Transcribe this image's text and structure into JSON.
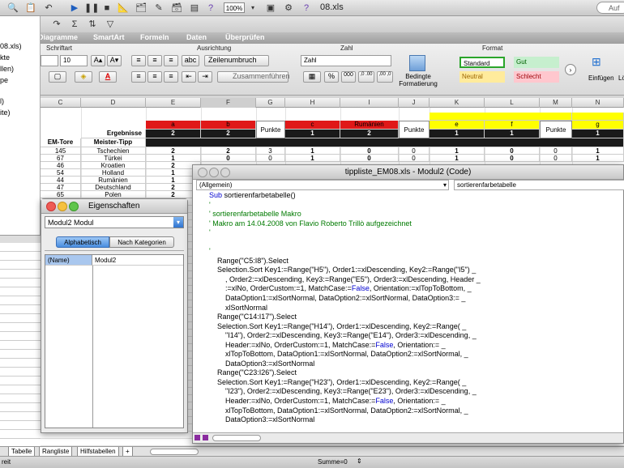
{
  "toolbar": {
    "zoom": "100%",
    "title": "08.xls",
    "search_placeholder": "Auf de"
  },
  "ribbon": {
    "tabs": [
      "Diagramme",
      "SmartArt",
      "Formeln",
      "Daten",
      "Überprüfen"
    ],
    "groups": {
      "schriftart": "Schriftart",
      "ausrichtung": "Ausrichtung",
      "zahl": "Zahl",
      "format": "Format"
    },
    "font_size": "10",
    "wrap_label": "Zeilenumbruch",
    "merge_label": "Zusammenführen",
    "number_format": "Zahl",
    "percent": "%",
    "thousands": "000",
    "dec_inc": ",0 .00",
    "dec_dec": ",00 ,0",
    "cond_format": [
      "Bedingte",
      "Formatierung"
    ],
    "styles": [
      {
        "label": "Standard",
        "bg": "#ffffff",
        "border": "#2aa52a"
      },
      {
        "label": "Gut",
        "bg": "#c6efce",
        "border": "#c6efce"
      },
      {
        "label": "Neutral",
        "bg": "#ffeb9c",
        "border": "#ffeb9c"
      },
      {
        "label": "Schlecht",
        "bg": "#ffc7ce",
        "border": "#ffc7ce"
      }
    ],
    "einfuegen": "Einfügen",
    "loeschen": "Lö"
  },
  "project_pane": {
    "lines": [
      "08.xls)",
      "kte",
      "llen)",
      "pe",
      "l)",
      "ite)"
    ]
  },
  "sheet": {
    "columns": [
      "C",
      "D",
      "E",
      "F",
      "G",
      "H",
      "I",
      "J",
      "K",
      "L",
      "M",
      "N"
    ],
    "ergebnisse": "Ergebnisse",
    "em_tore": "EM-Tore",
    "meister_tipp": "Meister-Tipp",
    "header_labels": {
      "e": "a",
      "f": "b",
      "g": "Punkte",
      "h": "c",
      "i": "Rumänien",
      "j": "Punkte",
      "k": "e",
      "l": "f",
      "m": "Punkte",
      "n": "g"
    },
    "score_row": [
      "2",
      "2",
      "",
      "1",
      "2",
      "",
      "1",
      "1",
      "",
      "1"
    ],
    "rows": [
      {
        "c": "145",
        "d": "Tschechien",
        "e": "2",
        "f": "2",
        "g": "3",
        "h": "1",
        "i": "0",
        "j": "0",
        "k": "1",
        "l": "0",
        "m": "0",
        "n": "1"
      },
      {
        "c": "67",
        "d": "Türkei",
        "e": "1",
        "f": "0",
        "g": "0",
        "h": "1",
        "i": "0",
        "j": "0",
        "k": "1",
        "l": "0",
        "m": "0",
        "n": "1"
      },
      {
        "c": "46",
        "d": "Kroatien",
        "e": "2",
        "f": "",
        "g": "",
        "h": "",
        "i": "",
        "j": "",
        "k": "",
        "l": "",
        "m": "",
        "n": ""
      },
      {
        "c": "54",
        "d": "Holland",
        "e": "1",
        "f": "",
        "g": "",
        "h": "",
        "i": "",
        "j": "",
        "k": "",
        "l": "",
        "m": "",
        "n": ""
      },
      {
        "c": "44",
        "d": "Rumänien",
        "e": "1",
        "f": "",
        "g": "",
        "h": "",
        "i": "",
        "j": "",
        "k": "",
        "l": "",
        "m": "",
        "n": ""
      },
      {
        "c": "47",
        "d": "Deutschland",
        "e": "2",
        "f": "",
        "g": "",
        "h": "",
        "i": "",
        "j": "",
        "k": "",
        "l": "",
        "m": "",
        "n": ""
      },
      {
        "c": "65",
        "d": "Polen",
        "e": "2",
        "f": "",
        "g": "",
        "h": "",
        "i": "",
        "j": "",
        "k": "",
        "l": "",
        "m": "",
        "n": ""
      }
    ],
    "tabs": [
      "Tabelle",
      "Rangliste",
      "Hilfstabellen"
    ],
    "add_tab": "+"
  },
  "statusbar": {
    "left": "reit",
    "sum": "Summe=0"
  },
  "properties": {
    "title": "Eigenschaften",
    "object": "Modul2  Modul",
    "tab_alpha": "Alphabetisch",
    "tab_cat": "Nach Kategorien",
    "prop_name": "(Name)",
    "prop_value": "Modul2"
  },
  "code_window": {
    "title": "tippliste_EM08.xls - Modul2 (Code)",
    "object_combo": "(Allgemein)",
    "proc_combo": "sortierenfarbetabelle",
    "lines": [
      {
        "t": "Sub sortierenfarbetabelle()",
        "k": "code"
      },
      {
        "t": "'",
        "k": "comment"
      },
      {
        "t": "' sortierenfarbetabelle Makro",
        "k": "comment"
      },
      {
        "t": "' Makro am 14.04.2008 von Flavio Roberto Trillò aufgezeichnet",
        "k": "comment"
      },
      {
        "t": "'",
        "k": "comment"
      },
      {
        "t": "",
        "k": "code"
      },
      {
        "t": "'",
        "k": "comment"
      },
      {
        "t": "    Range(\"C5:I8\").Select",
        "k": "code"
      },
      {
        "t": "    Selection.Sort Key1:=Range(\"H5\"), Order1:=xlDescending, Key2:=Range(\"I5\") _",
        "k": "code"
      },
      {
        "t": "        , Order2:=xlDescending, Key3:=Range(\"E5\"), Order3:=xlDescending, Header _",
        "k": "code"
      },
      {
        "t": "        :=xlNo, OrderCustom:=1, MatchCase:=False, Orientation:=xlTopToBottom, _",
        "k": "code"
      },
      {
        "t": "        DataOption1:=xlSortNormal, DataOption2:=xlSortNormal, DataOption3:= _",
        "k": "code"
      },
      {
        "t": "        xlSortNormal",
        "k": "code"
      },
      {
        "t": "    Range(\"C14:I17\").Select",
        "k": "code"
      },
      {
        "t": "    Selection.Sort Key1:=Range(\"H14\"), Order1:=xlDescending, Key2:=Range( _",
        "k": "code"
      },
      {
        "t": "        \"I14\"), Order2:=xlDescending, Key3:=Range(\"E14\"), Order3:=xlDescending, _",
        "k": "code"
      },
      {
        "t": "        Header:=xlNo, OrderCustom:=1, MatchCase:=False, Orientation:= _",
        "k": "code"
      },
      {
        "t": "        xlTopToBottom, DataOption1:=xlSortNormal, DataOption2:=xlSortNormal, _",
        "k": "code"
      },
      {
        "t": "        DataOption3:=xlSortNormal",
        "k": "code"
      },
      {
        "t": "    Range(\"C23:I26\").Select",
        "k": "code"
      },
      {
        "t": "    Selection.Sort Key1:=Range(\"H23\"), Order1:=xlDescending, Key2:=Range( _",
        "k": "code"
      },
      {
        "t": "        \"I23\"), Order2:=xlDescending, Key3:=Range(\"E23\"), Order3:=xlDescending, _",
        "k": "code"
      },
      {
        "t": "        Header:=xlNo, OrderCustom:=1, MatchCase:=False, Orientation:= _",
        "k": "code"
      },
      {
        "t": "        xlTopToBottom, DataOption1:=xlSortNormal, DataOption2:=xlSortNormal, _",
        "k": "code"
      },
      {
        "t": "        DataOption3:=xlSortNormal",
        "k": "code"
      }
    ]
  },
  "colors": {
    "red_header": "#e01818",
    "yellow_header": "#ffff00",
    "dark_header": "#1a1a1a"
  }
}
